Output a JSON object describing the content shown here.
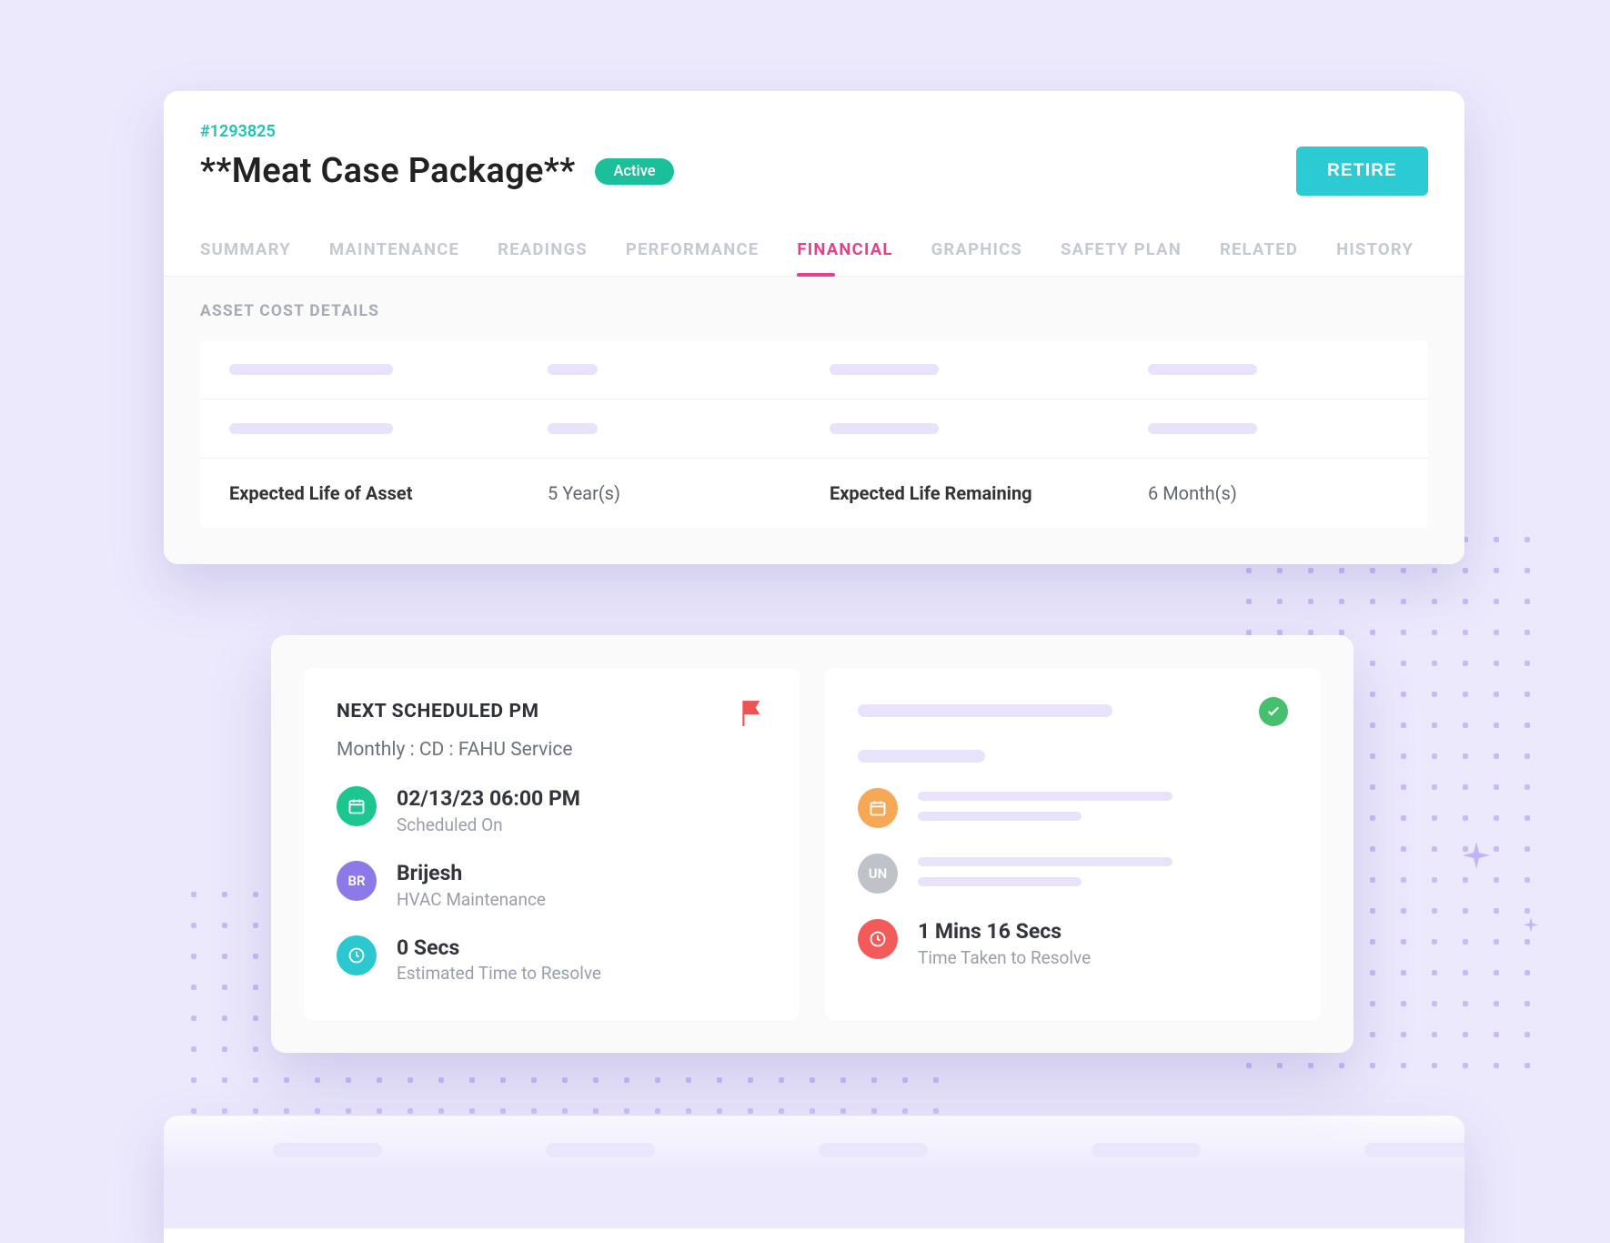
{
  "asset": {
    "id": "#1293825",
    "title": "**Meat Case Package**",
    "status": "Active"
  },
  "actions": {
    "retire": "RETIRE"
  },
  "tabs": [
    {
      "label": "SUMMARY",
      "active": false
    },
    {
      "label": "MAINTENANCE",
      "active": false
    },
    {
      "label": "READINGS",
      "active": false
    },
    {
      "label": "PERFORMANCE",
      "active": false
    },
    {
      "label": "FINANCIAL",
      "active": true
    },
    {
      "label": "GRAPHICS",
      "active": false
    },
    {
      "label": "SAFETY PLAN",
      "active": false
    },
    {
      "label": "RELATED",
      "active": false
    },
    {
      "label": "HISTORY",
      "active": false
    }
  ],
  "financial": {
    "section_label": "ASSET COST DETAILS",
    "rows": [
      {
        "label": "Expected Life of Asset",
        "value": "5 Year(s)",
        "label2": "Expected Life Remaining",
        "value2": "6 Month(s)"
      }
    ]
  },
  "pm": {
    "title": "NEXT SCHEDULED PM",
    "subtitle": "Monthly : CD : FAHU Service",
    "scheduled": {
      "value": "02/13/23 06:00 PM",
      "label": "Scheduled On"
    },
    "assignee": {
      "initials": "BR",
      "name": "Brijesh",
      "label": "HVAC Maintenance"
    },
    "estimate": {
      "value": "0 Secs",
      "label": "Estimated Time to Resolve"
    }
  },
  "completed": {
    "assignee_initials": "UN",
    "resolve": {
      "value": "1 Mins 16 Secs",
      "label": "Time Taken to Resolve"
    }
  }
}
